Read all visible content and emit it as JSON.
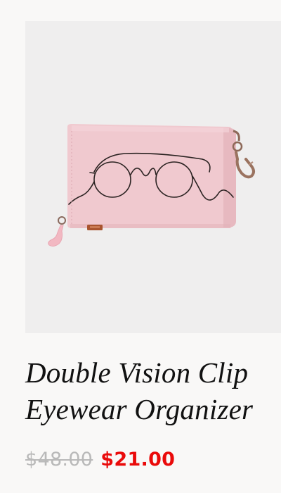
{
  "product": {
    "image_alt": "Pink eyewear organizer pouch with line-drawn glasses",
    "title_line1": "Double Vision Clip",
    "title_line2": "Eyewear Organizer",
    "price_original": "$48.00",
    "price_sale": "$21.00"
  },
  "colors": {
    "background": "#f9f8f7",
    "image_background": "#efeeee",
    "pouch": "#f0c9cf",
    "sale_price": "#ea0a0a",
    "original_price": "#b9b9b9"
  }
}
